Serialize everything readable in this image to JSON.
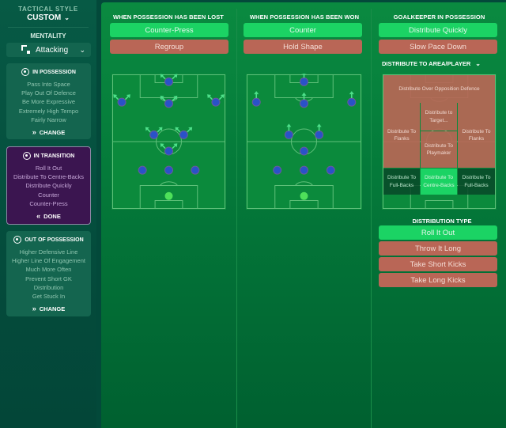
{
  "sidebar": {
    "tactical_style_label": "TACTICAL STYLE",
    "tactical_style_value": "CUSTOM",
    "mentality_label": "MENTALITY",
    "mentality_value": "Attacking",
    "in_possession": {
      "title": "IN POSSESSION",
      "items": [
        "Pass Into Space",
        "Play Out Of Defence",
        "Be More Expressive",
        "Extremely High Tempo",
        "Fairly Narrow"
      ],
      "button": "CHANGE"
    },
    "in_transition": {
      "title": "IN TRANSITION",
      "items": [
        "Roll It Out",
        "Distribute To Centre-Backs",
        "Distribute Quickly",
        "Counter",
        "Counter-Press"
      ],
      "button": "DONE"
    },
    "out_of_possession": {
      "title": "OUT OF POSSESSION",
      "items": [
        "Higher Defensive Line",
        "Higher Line Of Engagement",
        "Much More Often",
        "Prevent Short GK",
        "Distribution",
        "Get Stuck In"
      ],
      "button": "CHANGE"
    }
  },
  "columns": {
    "lost": {
      "title": "WHEN POSSESSION HAS BEEN LOST",
      "options": [
        {
          "label": "Counter-Press",
          "selected": true
        },
        {
          "label": "Regroup",
          "selected": false
        }
      ]
    },
    "won": {
      "title": "WHEN POSSESSION HAS BEEN WON",
      "options": [
        {
          "label": "Counter",
          "selected": true
        },
        {
          "label": "Hold Shape",
          "selected": false
        }
      ]
    },
    "goalkeeper": {
      "title": "GOALKEEPER IN POSSESSION",
      "options": [
        {
          "label": "Distribute Quickly",
          "selected": true
        },
        {
          "label": "Slow Pace Down",
          "selected": false
        }
      ],
      "distribute_title": "DISTRIBUTE TO AREA/PLAYER",
      "zones": {
        "over_defence": "Distribute Over Opposition Defence",
        "target": "Distribute to Target...",
        "flanks_left": "Distribute To Flanks",
        "flanks_right": "Distribute To Flanks",
        "playmaker": "Distribute To Playmaker",
        "fullbacks_left": "Distribute To Full-Backs",
        "centre_backs": "Distribute To Centre-Backs",
        "fullbacks_right": "Distribute To Full-Backs"
      },
      "selected_zone": "centre_backs",
      "distribution_type_title": "DISTRIBUTION TYPE",
      "distribution_types": [
        {
          "label": "Roll It Out",
          "selected": true
        },
        {
          "label": "Throw It Long",
          "selected": false
        },
        {
          "label": "Take Short Kicks",
          "selected": false
        },
        {
          "label": "Take Long Kicks",
          "selected": false
        }
      ]
    }
  },
  "colors": {
    "selected": "#1bd364",
    "unselected": "#b96656",
    "player": "#2a52c8",
    "goalkeeper": "#4ee05a",
    "arrow": "#4ee08a"
  }
}
